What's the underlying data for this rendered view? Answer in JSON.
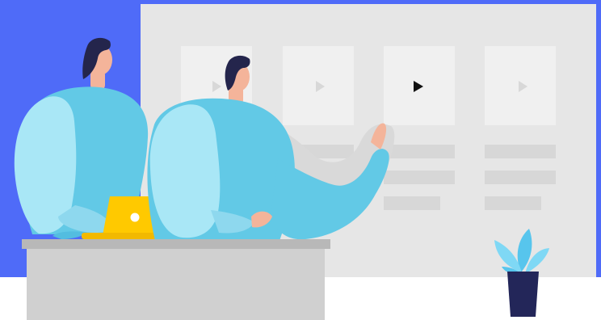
{
  "scene": {
    "description_free": true,
    "colors": {
      "accent_blue": "#4F6BF8",
      "screen": "#E6E6E6",
      "thumb": "#F0F0F0",
      "placeholder_line": "#D7D7D7",
      "play_inactive": "#D8D8D8",
      "play_active": "#111111",
      "person_shirt_light": "#A9E7F6",
      "person_shirt_mid": "#62C9E6",
      "person_shirt_shadow": "#53BDE0",
      "skin": "#F4B49A",
      "hair": "#24254C",
      "laptop": "#FFC900",
      "desk_top": "#B8B8B8",
      "desk_front": "#D0D0D0",
      "plant_pot": "#232659",
      "plant_leaf": "#7FD8F5",
      "plant_leaf_dark": "#57C5ED"
    },
    "icons": {
      "video_thumbnails": [
        "play-icon",
        "play-icon",
        "play-icon-active",
        "play-icon"
      ],
      "laptop": "laptop-icon",
      "plant": "plant-icon"
    }
  }
}
